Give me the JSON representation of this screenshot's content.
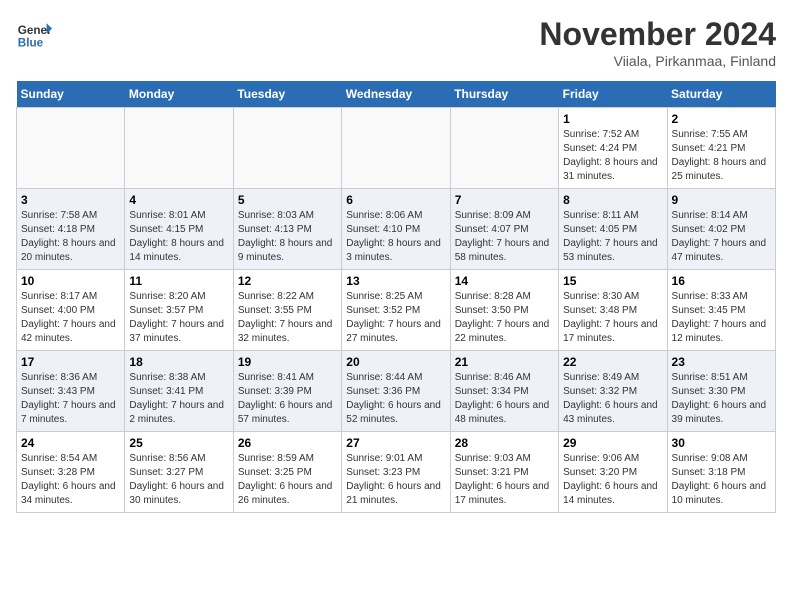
{
  "header": {
    "logo_line1": "General",
    "logo_line2": "Blue",
    "month": "November 2024",
    "location": "Viiala, Pirkanmaa, Finland"
  },
  "days_of_week": [
    "Sunday",
    "Monday",
    "Tuesday",
    "Wednesday",
    "Thursday",
    "Friday",
    "Saturday"
  ],
  "weeks": [
    [
      {
        "day": "",
        "info": ""
      },
      {
        "day": "",
        "info": ""
      },
      {
        "day": "",
        "info": ""
      },
      {
        "day": "",
        "info": ""
      },
      {
        "day": "",
        "info": ""
      },
      {
        "day": "1",
        "info": "Sunrise: 7:52 AM\nSunset: 4:24 PM\nDaylight: 8 hours and 31 minutes."
      },
      {
        "day": "2",
        "info": "Sunrise: 7:55 AM\nSunset: 4:21 PM\nDaylight: 8 hours and 25 minutes."
      }
    ],
    [
      {
        "day": "3",
        "info": "Sunrise: 7:58 AM\nSunset: 4:18 PM\nDaylight: 8 hours and 20 minutes."
      },
      {
        "day": "4",
        "info": "Sunrise: 8:01 AM\nSunset: 4:15 PM\nDaylight: 8 hours and 14 minutes."
      },
      {
        "day": "5",
        "info": "Sunrise: 8:03 AM\nSunset: 4:13 PM\nDaylight: 8 hours and 9 minutes."
      },
      {
        "day": "6",
        "info": "Sunrise: 8:06 AM\nSunset: 4:10 PM\nDaylight: 8 hours and 3 minutes."
      },
      {
        "day": "7",
        "info": "Sunrise: 8:09 AM\nSunset: 4:07 PM\nDaylight: 7 hours and 58 minutes."
      },
      {
        "day": "8",
        "info": "Sunrise: 8:11 AM\nSunset: 4:05 PM\nDaylight: 7 hours and 53 minutes."
      },
      {
        "day": "9",
        "info": "Sunrise: 8:14 AM\nSunset: 4:02 PM\nDaylight: 7 hours and 47 minutes."
      }
    ],
    [
      {
        "day": "10",
        "info": "Sunrise: 8:17 AM\nSunset: 4:00 PM\nDaylight: 7 hours and 42 minutes."
      },
      {
        "day": "11",
        "info": "Sunrise: 8:20 AM\nSunset: 3:57 PM\nDaylight: 7 hours and 37 minutes."
      },
      {
        "day": "12",
        "info": "Sunrise: 8:22 AM\nSunset: 3:55 PM\nDaylight: 7 hours and 32 minutes."
      },
      {
        "day": "13",
        "info": "Sunrise: 8:25 AM\nSunset: 3:52 PM\nDaylight: 7 hours and 27 minutes."
      },
      {
        "day": "14",
        "info": "Sunrise: 8:28 AM\nSunset: 3:50 PM\nDaylight: 7 hours and 22 minutes."
      },
      {
        "day": "15",
        "info": "Sunrise: 8:30 AM\nSunset: 3:48 PM\nDaylight: 7 hours and 17 minutes."
      },
      {
        "day": "16",
        "info": "Sunrise: 8:33 AM\nSunset: 3:45 PM\nDaylight: 7 hours and 12 minutes."
      }
    ],
    [
      {
        "day": "17",
        "info": "Sunrise: 8:36 AM\nSunset: 3:43 PM\nDaylight: 7 hours and 7 minutes."
      },
      {
        "day": "18",
        "info": "Sunrise: 8:38 AM\nSunset: 3:41 PM\nDaylight: 7 hours and 2 minutes."
      },
      {
        "day": "19",
        "info": "Sunrise: 8:41 AM\nSunset: 3:39 PM\nDaylight: 6 hours and 57 minutes."
      },
      {
        "day": "20",
        "info": "Sunrise: 8:44 AM\nSunset: 3:36 PM\nDaylight: 6 hours and 52 minutes."
      },
      {
        "day": "21",
        "info": "Sunrise: 8:46 AM\nSunset: 3:34 PM\nDaylight: 6 hours and 48 minutes."
      },
      {
        "day": "22",
        "info": "Sunrise: 8:49 AM\nSunset: 3:32 PM\nDaylight: 6 hours and 43 minutes."
      },
      {
        "day": "23",
        "info": "Sunrise: 8:51 AM\nSunset: 3:30 PM\nDaylight: 6 hours and 39 minutes."
      }
    ],
    [
      {
        "day": "24",
        "info": "Sunrise: 8:54 AM\nSunset: 3:28 PM\nDaylight: 6 hours and 34 minutes."
      },
      {
        "day": "25",
        "info": "Sunrise: 8:56 AM\nSunset: 3:27 PM\nDaylight: 6 hours and 30 minutes."
      },
      {
        "day": "26",
        "info": "Sunrise: 8:59 AM\nSunset: 3:25 PM\nDaylight: 6 hours and 26 minutes."
      },
      {
        "day": "27",
        "info": "Sunrise: 9:01 AM\nSunset: 3:23 PM\nDaylight: 6 hours and 21 minutes."
      },
      {
        "day": "28",
        "info": "Sunrise: 9:03 AM\nSunset: 3:21 PM\nDaylight: 6 hours and 17 minutes."
      },
      {
        "day": "29",
        "info": "Sunrise: 9:06 AM\nSunset: 3:20 PM\nDaylight: 6 hours and 14 minutes."
      },
      {
        "day": "30",
        "info": "Sunrise: 9:08 AM\nSunset: 3:18 PM\nDaylight: 6 hours and 10 minutes."
      }
    ]
  ]
}
